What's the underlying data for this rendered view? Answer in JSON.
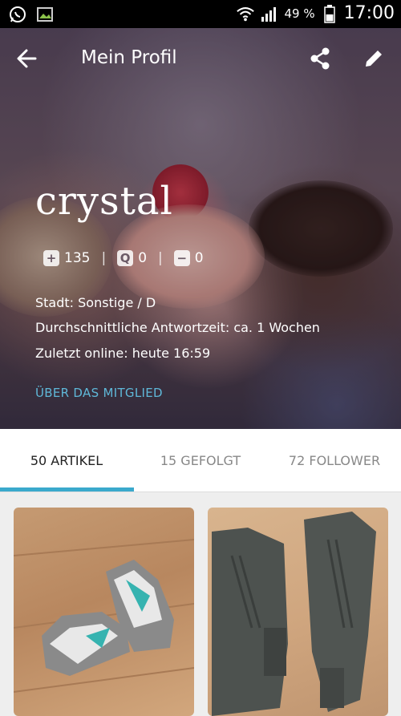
{
  "status_bar": {
    "battery": "49 %",
    "time": "17:00",
    "icons": [
      "whatsapp-icon",
      "image-icon",
      "wifi-icon",
      "signal-icon",
      "battery-icon"
    ]
  },
  "toolbar": {
    "title": "Mein Profil",
    "icons": [
      "back-arrow-icon",
      "share-icon",
      "edit-pencil-icon"
    ]
  },
  "profile": {
    "username": "crystal",
    "stats": {
      "points": "135",
      "questions": "0",
      "answers": "0"
    },
    "city_line": "Stadt: Sonstige / D",
    "response_line": "Durchschnittliche Antwortzeit: ca. 1 Wochen",
    "online_line": "Zuletzt online: heute 16:59",
    "about_link": "ÜBER DAS MITGLIED"
  },
  "tabs": [
    {
      "label": "50 ARTIKEL",
      "active": true
    },
    {
      "label": "15 GEFOLGT",
      "active": false
    },
    {
      "label": "72 FOLLOWER",
      "active": false
    }
  ],
  "colors": {
    "accent": "#3aa9cc",
    "link": "#5fb8d8"
  },
  "items": [
    {
      "image": "sneakers-photo"
    },
    {
      "image": "boots-photo"
    }
  ]
}
